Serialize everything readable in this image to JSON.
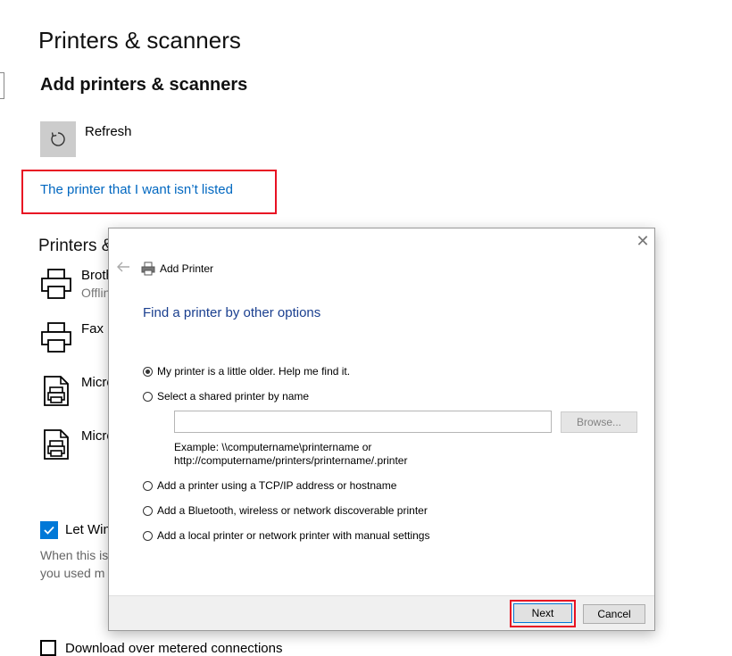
{
  "settings": {
    "page_title": "Printers & scanners",
    "add_heading": "Add printers & scanners",
    "refresh_label": "Refresh",
    "not_listed_link": "The printer that I want isn’t listed",
    "printers_heading": "Printers &",
    "devices": [
      {
        "name": "Broth",
        "status": "Offlin",
        "icon": "printer-icon"
      },
      {
        "name": "Fax",
        "status": "",
        "icon": "printer-icon"
      },
      {
        "name": "Micro",
        "status": "",
        "icon": "document-printer-icon"
      },
      {
        "name": "Micro",
        "status": "",
        "icon": "document-printer-icon"
      }
    ],
    "let_windows_label": "Let Win",
    "let_windows_checked": true,
    "desc_line1": "When this is",
    "desc_line2": "you used m",
    "metered_label": "Download over metered connections",
    "metered_checked": false,
    "accent_color": "#0078d7",
    "highlight_color": "#e81123"
  },
  "dialog": {
    "title": "Add Printer",
    "heading": "Find a printer by other options",
    "options": [
      {
        "label": "My printer is a little older. Help me find it.",
        "selected": true
      },
      {
        "label": "Select a shared printer by name",
        "selected": false
      },
      {
        "label": "Add a printer using a TCP/IP address or hostname",
        "selected": false
      },
      {
        "label": "Add a Bluetooth, wireless or network discoverable printer",
        "selected": false
      },
      {
        "label": "Add a local printer or network printer with manual settings",
        "selected": false
      }
    ],
    "shared_name_value": "",
    "browse_label": "Browse...",
    "example_line1": "Example: \\\\computername\\printername or",
    "example_line2": "http://computername/printers/printername/.printer",
    "next_label": "Next",
    "cancel_label": "Cancel"
  }
}
